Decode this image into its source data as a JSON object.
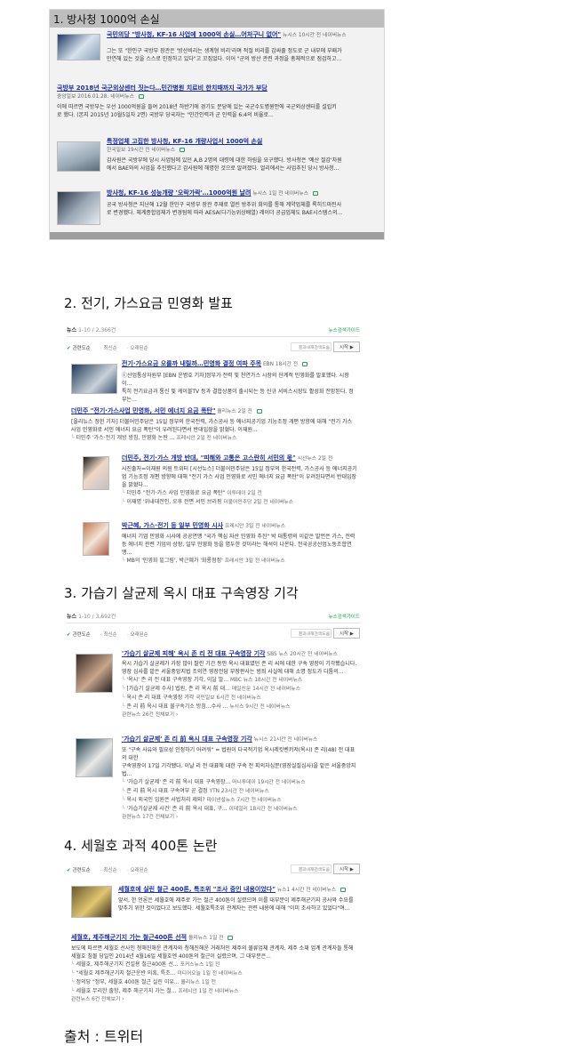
{
  "sec1": {
    "title": "1. 방사청 1000억 손실",
    "items": [
      {
        "title": "국민의당 \"방사청, KF-16 사업에 1000억 손실…어처구니 없어\"",
        "src": "뉴시스",
        "time": "10시간 전",
        "via": "네이버뉴스",
        "body1": "그는 또 \"한민구 국방부 장관은 '방산비리는 생계형 비리'라며 적절 비리를 감싸줄 정도로 군 내부에 부패가",
        "body2": "만연해 있는 것을 스스로 인정하고 있다\"고 꼬집었다. 이어 \"군의 방산 관련 과정을 총체적으로 점검하고..."
      },
      {
        "title": "국방부 2018년 국군외상센터 짓는다…민간병원 치료비 한치때까지 국가가 부담",
        "src": "중앙일보",
        "time": "2016.01.28.",
        "via": "네이버뉴스",
        "body1": "이에 따르면 국방부는 우선 1000억원을 들여 2018년 하반기에 경기도 분당에 있는 국군수도병원안에 국군외상센터를 설립키",
        "body2": "로 했다. (본지 2015년 10월5일자 2면) 국방부 당국자는 \"민간인력과 군 인력을 6:4의 비율로..."
      },
      {
        "title": "특정업체 고집한 방사청, KF-16 개량사업서 1000억 손실",
        "src": "한국일보",
        "time": "19시간 전",
        "via": "네이버뉴스",
        "body1": "감사원은 국방부에 당시 사업팀에 있던 A,B 2명의 대령에 대한 하림을 요구했다. 방사청은 '예산 절감'차원",
        "body2": "에서 BAE와의 사업을 추진했다고 감사원에 해명한 것으로 알려졌다. 얼리에서는 사업추진 당시 방사청..."
      },
      {
        "title": "방사청, KF-16 성능개량 '오락가락'…1000억원 날려",
        "src": "뉴시스",
        "time": "1일 전",
        "via": "네이버뉴스",
        "body1": "공국 방사청은 지난해 12월 한민구 국방부 장관 주재로 열린 방추위 회의를 통해 계약업체를 록히드마틴사",
        "body2": "로 변경했다. 체계종합업체가 변경됨에 따라 AESA(다기능위상배열) 레이더 공급업체도 BAE시스템스의..."
      }
    ]
  },
  "sec2": {
    "title": "2. 전기, 가스요금 민영화 발표",
    "news_label": "뉴스",
    "count": "1-10 / 2,366건",
    "guide": "뉴스검색가이드",
    "filters": [
      "관련도순",
      "최신순",
      "오래된순"
    ],
    "search_placeholder": "결과내재검색도움",
    "search_btn": "시작 ▶",
    "items": [
      {
        "title": "전기·가스요금 오를까 내릴까…민영화 결정 여파 주목",
        "src": "EBN",
        "time": "18시간 전",
        "body1": "ⓒ산업통상자원부 [EBN 운병호 기자]정부가 전력 및 천연가스 시장의 단계적 민영화를 발표했다. 시장이...",
        "body2": "특히 전기요금과 통신 및 케이블TV 등과 결합상품이 출시되는 등 신규 서비스시장도 활성화 전망된다. 정부는..."
      },
      {
        "title": "더민주 \"전기·가스사업 민영화, 서민 에너지 요금 폭탄\"",
        "src": "올리뉴스",
        "time": "2일 전",
        "body1": "[올리뉴스 정한 기자] 더불어민주당은 15일 정부의 한국전력, 가스공사 등 에너지공기업 기능조정 개편 방향에 대해 \"전기 가스",
        "body2": "사업 민영화로 서민 에너지 요금 폭탄\"이 우려된다면서 반대입장을 밝혔다. 이재원...",
        "rel": [
          {
            "t": "더민주 '가스·전기 개방 방침, 민영화 논란 ...",
            "s": "프레시안",
            "time": "2일 전"
          }
        ]
      },
      {
        "title": "더민주, 전기·가스 개방 반대, \"피해와 고통은 고스란히 서민의 몫\"",
        "src": "시선뉴스",
        "time": "2일 전",
        "body1": "사진출처=이재원 의원 트위터 [시선뉴스] 더불어민주당은 15일 정부의 한국전력, 가스공사 등 에너지공기",
        "body2": "업 기능조정 개편 방향에 대해 \"전기 가스 사업 민영화로 서민 에너지 요금 폭탄\"이 우려된다면서 반대입장",
        "body3": "을 밝혔다...",
        "rel": [
          {
            "t": "더민주 \"전기·가스 사업 민영화로 요금 폭탄\"",
            "s": "이투데이",
            "time": "2일 전"
          },
          {
            "t": "이재명 '위내대전인, 오후 전면 서민 브리핑",
            "s": "더불어민주당",
            "time": "2일 전"
          }
        ]
      },
      {
        "title": "박근혜, 가스·전기 등 일부 민영화 시사",
        "src": "프레시안",
        "time": "3일 전",
        "body1": "에너지 기업 민영화 시사에 공공연맹 \"국가 핵심 자산 민영화 추진\" 박 대통령의 이같은 발언은 가스, 전력",
        "body2": "등 에너지 관련 기업의 상장, 일부 민영화 등을 염두한 것이라는 해석이 나온다. 전국공공산업노동조합연",
        "body3": "맹...",
        "rel": [
          {
            "t": "MB의 '민영화 밑그림', 박근혜가 '화룡점정'",
            "s": "프레시안",
            "time": "3일 전"
          }
        ]
      }
    ]
  },
  "sec3": {
    "title": "3. 가습기 살균제 옥시 대표 구속영장 기각",
    "news_label": "뉴스",
    "count": "1-10 / 3,692건",
    "guide": "뉴스검색가이드",
    "filters": [
      "관련도순",
      "최신순",
      "오래된순"
    ],
    "search_placeholder": "결과내재검색도움",
    "search_btn": "시작 ▶",
    "items": [
      {
        "title": "'가습기 살균제 피해' 옥시 존 리 전 대표 구속영장 기각",
        "src": "SBS 뉴스",
        "time": "20시간 전",
        "body1": "옥시 가습기 살균제가 가장 많이 팔린 기간 동안 옥시 대표였던 존 리 씨에 대한 구속 영장이 기각됐습니다.",
        "body2": "영장 심사를 맡은 서울중앙지법 조의연 영장전담 부장판사는 범죄 사실에 대해 소명 정도가 다툼의...",
        "rel": [
          {
            "t": "'옥시' 존 리 전 대표 구속영장 기각, 이달 말...",
            "s": "MBC 뉴스",
            "time": "18시간 전"
          },
          {
            "t": "[가습기 살균제 수사] 법원, 존 리 옥시 前 대...",
            "s": "매일신문",
            "time": "14시간 전"
          },
          {
            "t": "옥시 존 리 대표 구속영장 기각",
            "s": "국민일보",
            "time": "6시간 전"
          },
          {
            "t": "존 리 前 옥시 대표 불구속기소 방침…수사 ...",
            "s": "뉴시스",
            "time": "9시간 전"
          }
        ],
        "more": "관련뉴스 26건 전체보기 ›"
      },
      {
        "title": "'가습기 살균제' 존 리 前 옥시 대표 구속영장 기각",
        "src": "뉴시스",
        "time": "21시간 전",
        "body1": "또 \"구속 사유와 필요성 인정하기 어려워\" = 법원이 다국적기업 옥시레킷벤키저(옥시) 존 리(48) 전 대표의 대한",
        "body2": "구속영장이 17일 기각됐다. 이날 리 전 대표에 대한 구속 전 피의자심문(영장실질심사)을 맡은 서울중앙지",
        "body3": "법...",
        "rel": [
          {
            "t": "'가습기 살균제' 존 리 前 옥시 대표 구속영장...",
            "s": "머니투데이",
            "time": "19시간 전"
          },
          {
            "t": "존 리 前 옥시 대표 구속여부 곧 결정",
            "s": "YTN",
            "time": "23시간 전"
          },
          {
            "t": "옥시 외국인 임원은 사법처리 제외?",
            "s": "파이낸셜뉴스",
            "time": "7시간 전"
          },
          {
            "t": "'가습기살균제 사건' 존 리 前 옥시 대표, 구...",
            "s": "이데일리",
            "time": "18시간 전"
          }
        ],
        "more": "관련뉴스 17건 전체보기 ›"
      }
    ]
  },
  "sec4": {
    "title": "4. 세월호 과적 400톤 논란",
    "filters": [
      "관련도순",
      "최신순",
      "오래된순"
    ],
    "search_placeholder": "결과내재검색도움",
    "search_btn": "시작 ▶",
    "items": [
      {
        "title": "세월호에 실린 철근 400톤, 특조위 \"조사 중인 내용이었다\"",
        "src": "뉴스1",
        "time": "4시간 전",
        "body1": "앞서, 한 언론은 세월호에 제주로 가는 철근 400톤이 실렸으며 이를 대부분이 제주해군기지 공사와 수요를",
        "body2": "맞추기 위한 것이었다고 보도했다. 세월호특조위 관계자는 관련 내용에 대해 \"이미 조사하고 있었다\"며..."
      },
      {
        "title": "세월호, 제주해군기지 가는 철근400톤 선적",
        "src": "올리뉴스",
        "time": "1일 전",
        "body1": "보도에 따르면 세월호 선사인 청해진해운 관계자와 청해진해운 거래처인 제주의 물류업체 관계자, 제주 소재 업계 관계자들 통해",
        "body2": "세월호 침몰 당일인 2014년 4월16일 세월호엔 400톤의 철근이 실렸으며, 그 대부분은...",
        "rel": [
          {
            "t": "세월호, 제주해군기지 건설용 철근400톤 선...",
            "s": "포커스뉴스",
            "time": "1일 전"
          },
          {
            "t": "\"세월호 제주해군기지 철근운반 의혹, 특조...",
            "s": "미디어오늘",
            "time": "1일 전"
          },
          {
            "t": "정의당 \"정부, 세월호 400톤 철근 실린 이유...",
            "s": "올리뉴스",
            "time": "1일 전"
          },
          {
            "t": "세월호 무리한 출항, 제주 해군기지 가는 철...",
            "s": "프레시안",
            "time": "1일 전"
          }
        ],
        "more": "관련뉴스 6건 전체보기 ›"
      }
    ]
  },
  "via": "네이버뉴스",
  "source": "출처 : 트위터"
}
